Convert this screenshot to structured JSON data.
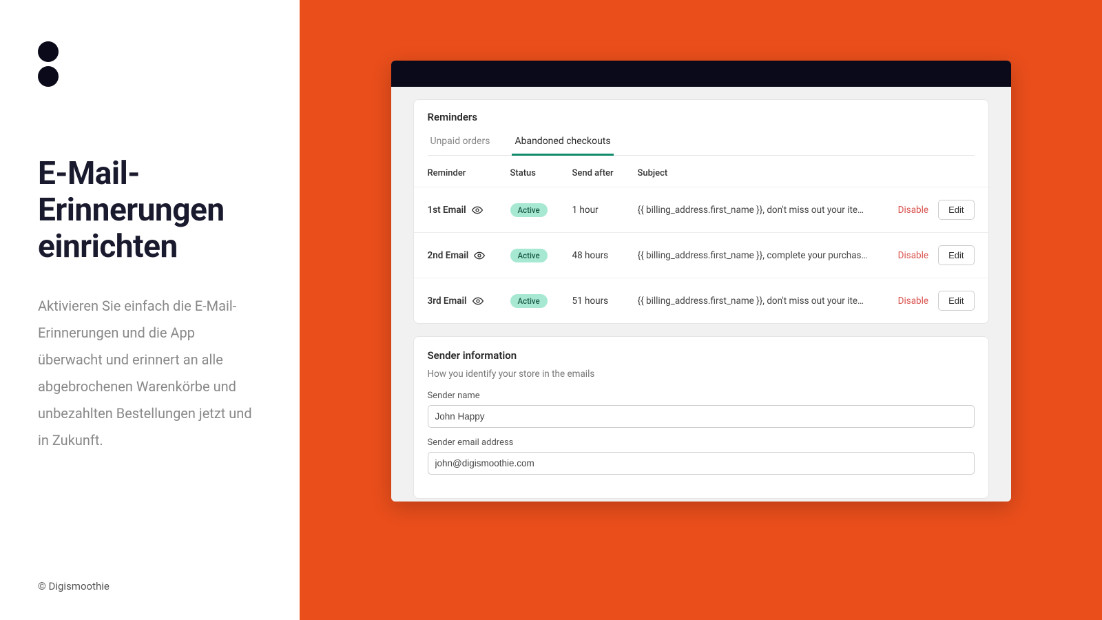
{
  "slide": {
    "headline": "E-Mail-Erinnerungen einrichten",
    "description": "Aktivieren Sie einfach die E-Mail-Erinnerungen und die App überwacht und erinnert an alle abgebrochenen Warenkörbe und unbezahlten Bestellungen jetzt und in Zukunft.",
    "credit": "© Digismoothie"
  },
  "app": {
    "reminders_title": "Reminders",
    "tabs": {
      "unpaid": "Unpaid orders",
      "abandoned": "Abandoned checkouts"
    },
    "columns": {
      "reminder": "Reminder",
      "status": "Status",
      "send_after": "Send after",
      "subject": "Subject"
    },
    "rows": [
      {
        "label": "1st Email",
        "status": "Active",
        "send_after": "1 hour",
        "subject": "{{ billing_address.first_name }}, don't miss out your items!",
        "disable": "Disable",
        "edit": "Edit"
      },
      {
        "label": "2nd Email",
        "status": "Active",
        "send_after": "48 hours",
        "subject": "{{ billing_address.first_name }}, complete your purchase in a fe...",
        "disable": "Disable",
        "edit": "Edit"
      },
      {
        "label": "3rd Email",
        "status": "Active",
        "send_after": "51 hours",
        "subject": "{{ billing_address.first_name }}, don't miss out your items!",
        "disable": "Disable",
        "edit": "Edit"
      }
    ],
    "sender": {
      "title": "Sender information",
      "subtitle": "How you identify your store in the emails",
      "name_label": "Sender name",
      "name_value": "John Happy",
      "email_label": "Sender email address",
      "email_value": "john@digismoothie.com"
    }
  }
}
